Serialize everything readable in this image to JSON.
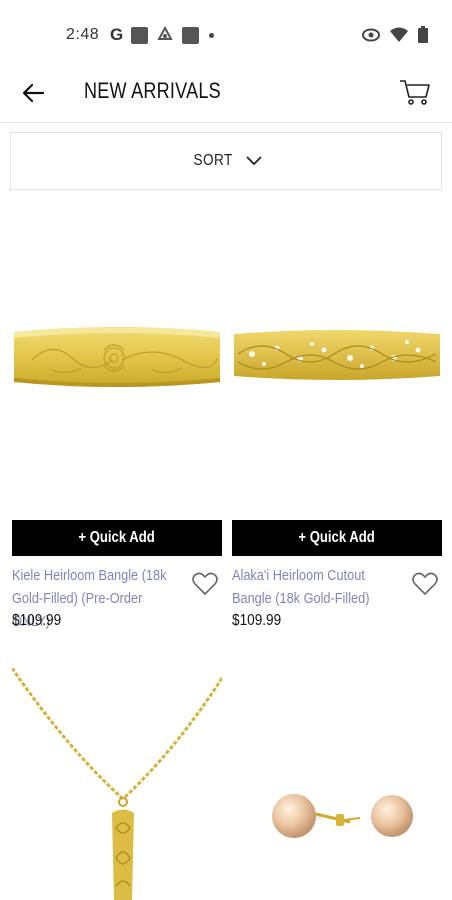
{
  "status_bar": {
    "time": "2:48",
    "google_letter": "G"
  },
  "appbar": {
    "title": "NEW ARRIVALS"
  },
  "sort": {
    "label": "SORT"
  },
  "products": [
    {
      "name": "Kiele Heirloom Bangle (18k Gold-Filled) (Pre-Order ONLY)",
      "price": "$109.99",
      "quick_add": "+ Quick Add"
    },
    {
      "name": "Alaka'i Heirloom Cutout Bangle (18k Gold-Filled)",
      "price": "$109.99",
      "quick_add": "+ Quick Add"
    }
  ],
  "colors": {
    "product_name": "#7f86b3",
    "quick_add_bg": "#000000",
    "gold": "#e3c84a"
  }
}
